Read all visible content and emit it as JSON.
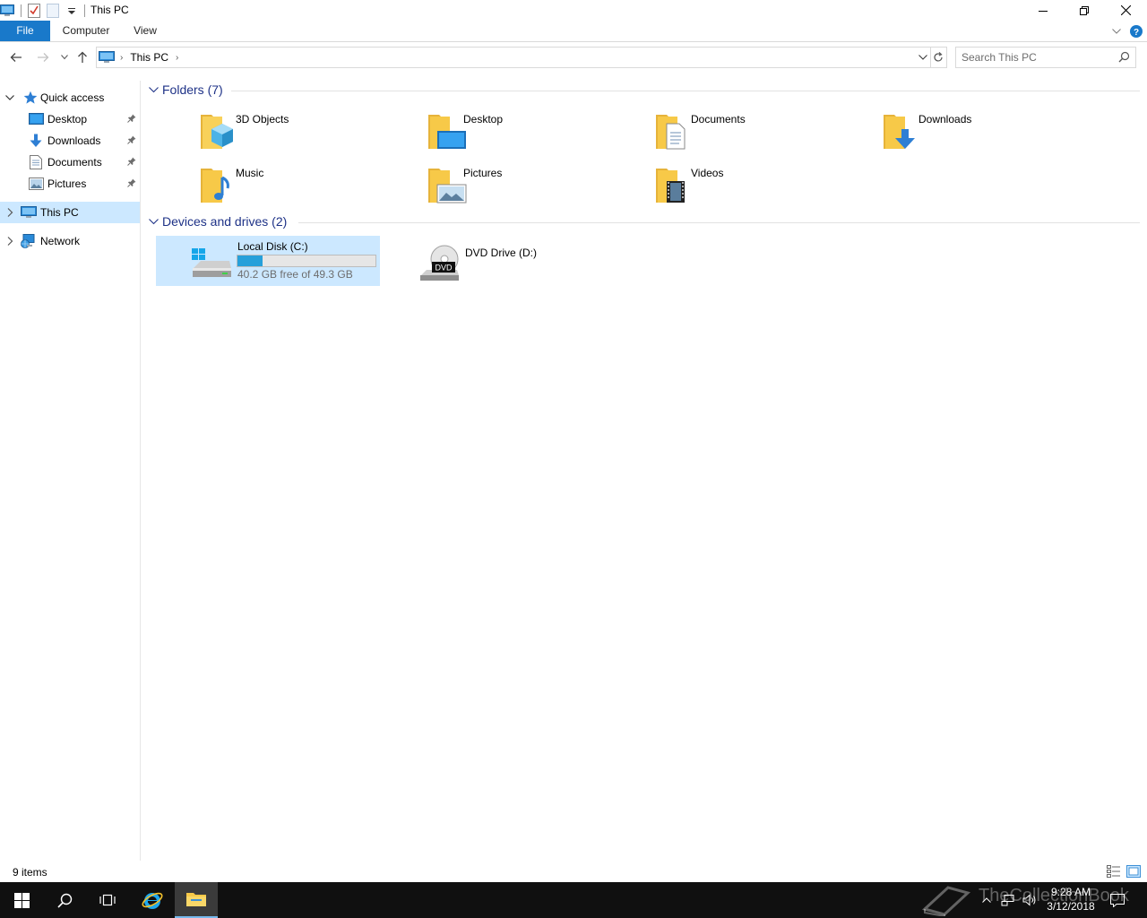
{
  "window": {
    "title": "This PC"
  },
  "ribbon": {
    "tabs": [
      "File",
      "Computer",
      "View"
    ]
  },
  "address": {
    "breadcrumb": [
      "This PC"
    ],
    "search_placeholder": "Search This PC"
  },
  "navpane": {
    "quick_access": "Quick access",
    "pinned": [
      "Desktop",
      "Downloads",
      "Documents",
      "Pictures"
    ],
    "this_pc": "This PC",
    "network": "Network"
  },
  "groups": {
    "folders": {
      "title": "Folders (7)",
      "items": [
        "3D Objects",
        "Desktop",
        "Documents",
        "Downloads",
        "Music",
        "Pictures",
        "Videos"
      ]
    },
    "drives": {
      "title": "Devices and drives (2)",
      "items": [
        {
          "name": "Local Disk (C:)",
          "free_text": "40.2 GB free of 49.3 GB",
          "used_fraction": 0.185
        },
        {
          "name": "DVD Drive (D:)",
          "dvd_label": "DVD"
        }
      ]
    }
  },
  "status": {
    "count": "9 items"
  },
  "taskbar": {
    "time": "9:28 AM",
    "date": "3/12/2018",
    "watermark": "TheCollectionBook"
  },
  "colors": {
    "accent": "#1979ca",
    "selection": "#cce8ff",
    "folder": "#f7c948",
    "drive_bar": "#26a0da",
    "group_title": "#1e3287"
  }
}
